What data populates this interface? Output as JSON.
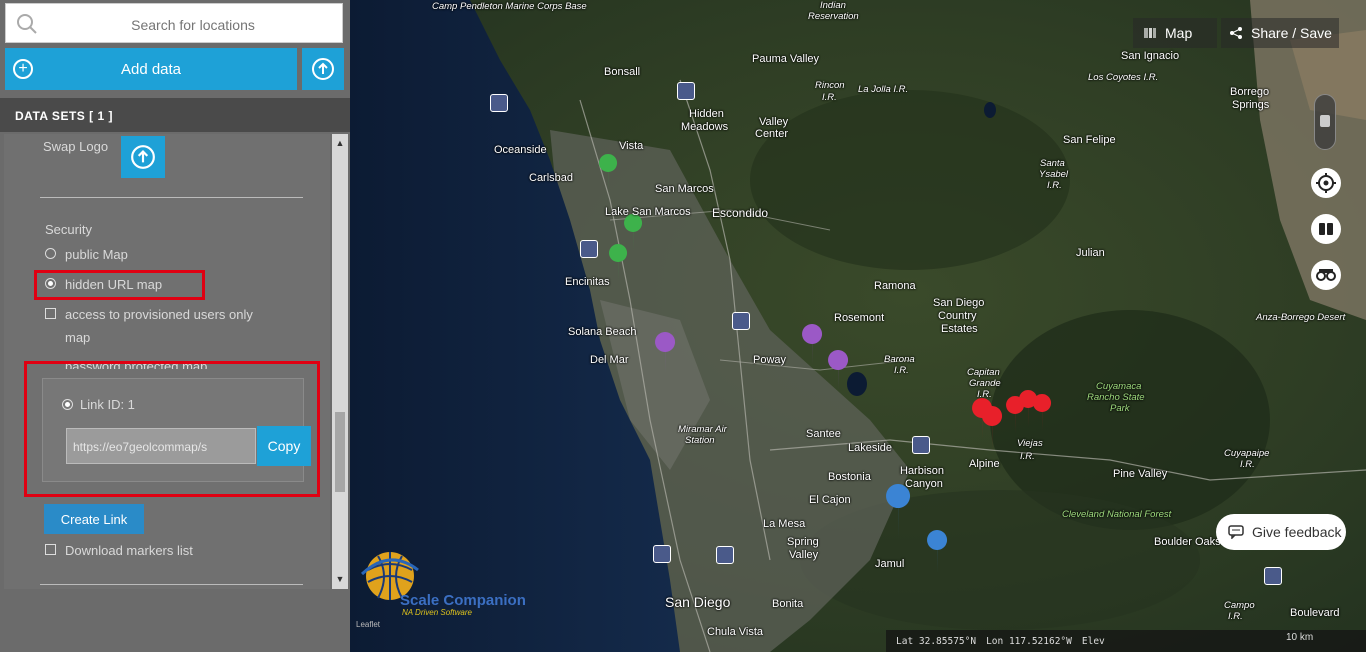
{
  "search": {
    "placeholder": "Search for locations"
  },
  "toolbar": {
    "add_data_label": "Add data"
  },
  "datasets": {
    "header": "DATA SETS   [ 1 ]"
  },
  "panel": {
    "swap_logo_label": "Swap Logo",
    "security_label": "Security",
    "options": {
      "public": "public Map",
      "hidden": "hidden URL map",
      "provisioned_line1": "access to provisioned users only",
      "provisioned_line2": "map",
      "password": "password protected map"
    },
    "link_label": "Link ID: 1",
    "link_url": "https://eo7geolcommap/s",
    "copy_label": "Copy",
    "create_link_label": "Create Link",
    "download_markers_label": "Download markers list"
  },
  "map": {
    "map_button": "Map",
    "share_button": "Share / Save",
    "feedback_button": "Give feedback",
    "coords": {
      "lat": "Lat  32.85575°N",
      "lon": "Lon  117.52162°W",
      "elev": "Elev"
    },
    "scale": "10 km",
    "logo": {
      "name": "Scale Companion",
      "tagline": "NA Driven Software",
      "small": "Leaflet"
    },
    "labels": {
      "camp_pendleton": "Camp Pendleton Marine Corps Base",
      "indian": "Indian",
      "reservation": "Reservation",
      "pauma_valley": "Pauma Valley",
      "san_ignacio": "San Ignacio",
      "los_coyotes": "Los Coyotes I.R.",
      "bonsall": "Bonsall",
      "rincon": "Rincon",
      "ir1": "I.R.",
      "la_jolla": "La Jolla I.R.",
      "borrego": "Borrego",
      "springs": "Springs",
      "hidden": "Hidden",
      "meadows": "Meadows",
      "valley": "Valley",
      "center": "Center",
      "san_felipe": "San Felipe",
      "oceanside": "Oceanside",
      "vista": "Vista",
      "santa": "Santa",
      "ysabel": "Ysabel",
      "ir2": "I.R.",
      "carlsbad": "Carlsbad",
      "san_marcos": "San Marcos",
      "lake_san_marcos": "Lake San Marcos",
      "escondido": "Escondido",
      "julian": "Julian",
      "encinitas": "Encinitas",
      "ramona": "Ramona",
      "sd_country": "San Diego",
      "sd_country2": "Country",
      "sd_country3": "Estates",
      "anza": "Anza-Borrego Desert",
      "solana_beach": "Solana Beach",
      "rosemont": "Rosemont",
      "del_mar": "Del Mar",
      "poway": "Poway",
      "barona": "Barona",
      "ir3": "I.R.",
      "capitan": "Capitan",
      "grande": "Grande",
      "ir4": "I.R.",
      "cuyamaca": "Cuyamaca",
      "rancho": "Rancho State",
      "park": "Park",
      "miramar": "Miramar Air",
      "station": "Station",
      "viejas": "Viejas",
      "ir5": "I.R.",
      "santee": "Santee",
      "lakeside": "Lakeside",
      "pine_valley": "Pine Valley",
      "cuyapaipe": "Cuyapaipe",
      "ir6": "I.R.",
      "alpine": "Alpine",
      "harbison": "Harbison",
      "canyon": "Canyon",
      "bostonia": "Bostonia",
      "el_cajon": "El Cajon",
      "cleveland": "Cleveland National Forest",
      "la_mesa": "La Mesa",
      "spring": "Spring",
      "valley2": "Valley",
      "jamul": "Jamul",
      "boulder_oaks": "Boulder Oaks",
      "san_diego": "San Diego",
      "bonita": "Bonita",
      "chula_vista": "Chula Vista",
      "campo": "Campo",
      "ir7": "I.R.",
      "boulevard": "Boulevard"
    }
  },
  "colors": {
    "accent": "#1ea1d7",
    "highlight": "#e00012",
    "pin_green": "#3db24b",
    "pin_purple": "#9b59c6",
    "pin_blue": "#3b84d4",
    "pin_red": "#e8202a"
  },
  "icons": [
    "search-icon",
    "plus-circle-icon",
    "upload-icon",
    "chevron-left-icon",
    "map-layers-icon",
    "share-icon",
    "compass-icon",
    "split-view-icon",
    "binoculars-icon",
    "chat-icon"
  ]
}
